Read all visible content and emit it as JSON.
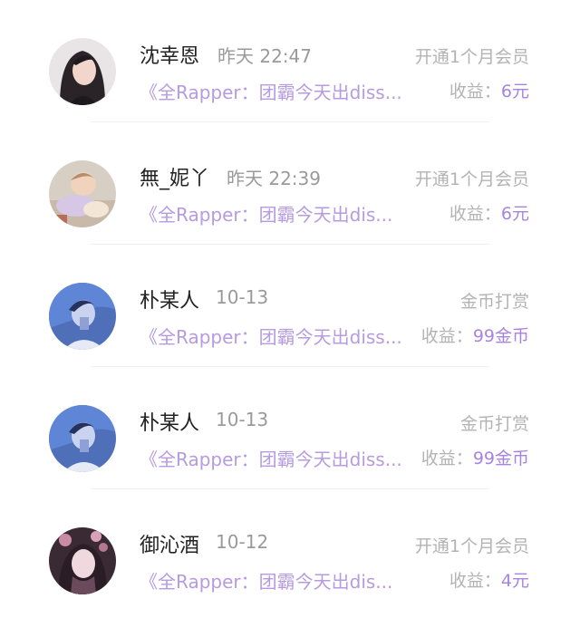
{
  "items": [
    {
      "name": "沈幸恩",
      "time": "昨天 22:47",
      "type": "开通1个月会员",
      "post": "《全Rapper：团霸今天出diss...",
      "earn_label": "收益：",
      "earn_value": "6元",
      "avatar": "portrait-woman-dark-hair"
    },
    {
      "name": "無_妮丫",
      "time": "昨天 22:39",
      "type": "开通1个月会员",
      "post": "《全Rapper：团霸今天出dis...",
      "earn_label": "收益：",
      "earn_value": "6元",
      "avatar": "child-lying-down"
    },
    {
      "name": "朴某人",
      "time": "10-13",
      "type": "金币打赏",
      "post": "《全Rapper：团霸今天出diss...",
      "earn_label": "收益：",
      "earn_value": "99金币",
      "avatar": "blue-tinted-portrait"
    },
    {
      "name": "朴某人",
      "time": "10-13",
      "type": "金币打赏",
      "post": "《全Rapper：团霸今天出diss...",
      "earn_label": "收益：",
      "earn_value": "99金币",
      "avatar": "blue-tinted-portrait"
    },
    {
      "name": "御沁酒",
      "time": "10-12",
      "type": "开通1个月会员",
      "post": "《全Rapper：团霸今天出dis...",
      "earn_label": "收益：",
      "earn_value": "4元",
      "avatar": "illustrated-girl-flowers"
    }
  ],
  "colors": {
    "accent": "#a784e0",
    "link": "#b69be0",
    "muted": "#b3b3b3"
  }
}
